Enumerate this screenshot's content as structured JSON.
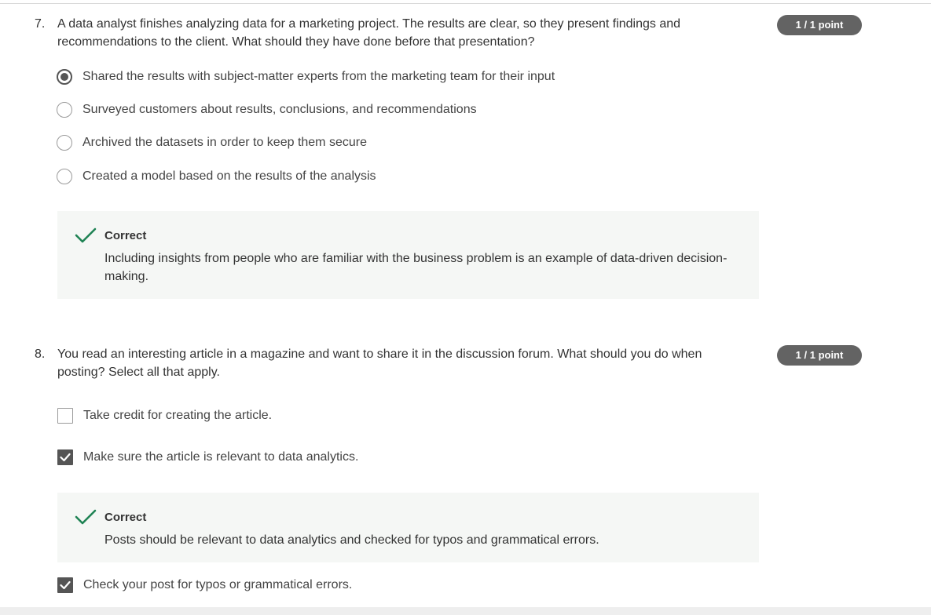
{
  "questions": [
    {
      "number": "7.",
      "text": "A data analyst finishes analyzing data for a marketing project. The results are clear, so they present findings and recommendations to the client. What should they have done before that presentation?",
      "points": "1 / 1 point",
      "options": [
        {
          "label": "Shared the results with subject-matter experts from the marketing team for their input",
          "selected": true
        },
        {
          "label": "Surveyed customers about results, conclusions, and recommendations",
          "selected": false
        },
        {
          "label": "Archived the datasets in order to keep them secure",
          "selected": false
        },
        {
          "label": "Created a model based on the results of the analysis",
          "selected": false
        }
      ],
      "feedback": {
        "title": "Correct",
        "text": "Including insights from people who are familiar with the business problem is an example of data-driven decision-making."
      }
    },
    {
      "number": "8.",
      "text": "You read an interesting article in a magazine and want to share it in the discussion forum. What should you do when posting? Select all that apply.",
      "points": "1 / 1 point",
      "options": [
        {
          "label": "Take credit for creating the article.",
          "checked": false
        },
        {
          "label": "Make sure the article is relevant to data analytics.",
          "checked": true
        },
        {
          "label": "Check your post for typos or grammatical errors.",
          "checked": true
        }
      ],
      "feedback": {
        "title": "Correct",
        "text": "Posts should be relevant to data analytics and checked for typos and grammatical errors."
      }
    }
  ],
  "colors": {
    "correct_green": "#1f8354",
    "badge_bg": "#636363",
    "feedback_bg": "#f5f7f5"
  },
  "icons": {
    "correct": "checkmark-icon",
    "checked_box": "checkbox-checked-icon",
    "radio_selected": "radio-selected-icon"
  }
}
